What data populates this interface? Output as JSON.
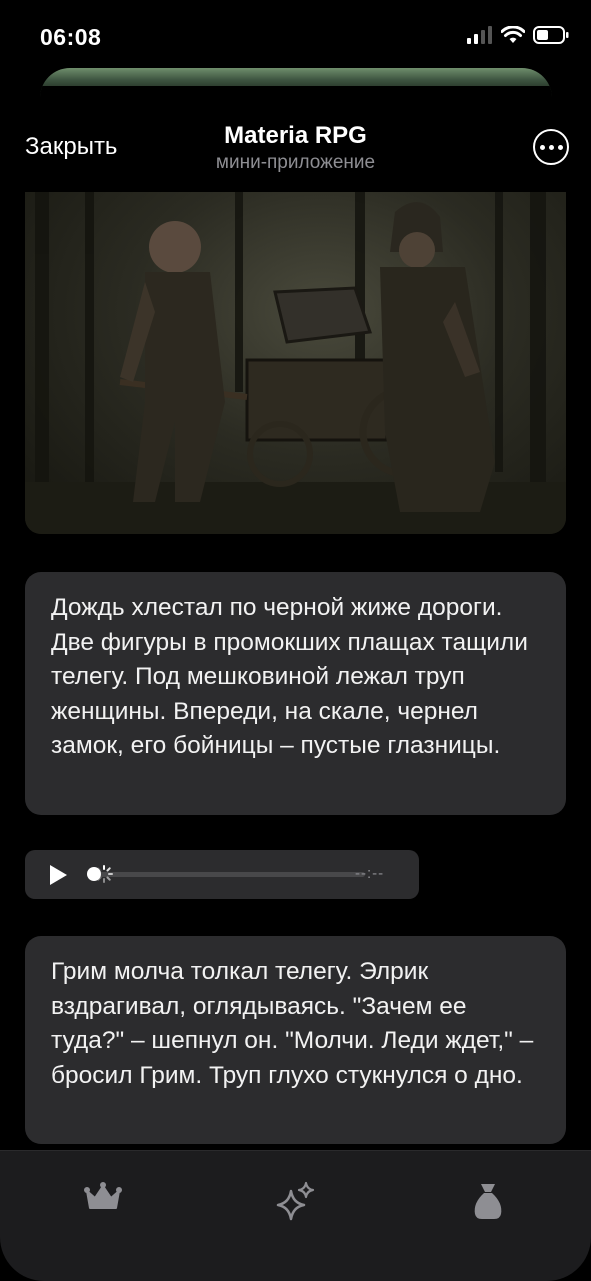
{
  "status_bar": {
    "time": "06:08",
    "icons": [
      "cellular-signal-icon",
      "wifi-icon",
      "battery-icon"
    ]
  },
  "header": {
    "close_label": "Закрыть",
    "title": "Materia RPG",
    "subtitle": "мини-приложение",
    "more_icon": "more-circle-icon"
  },
  "story": {
    "image_alt": "scene-illustration",
    "paragraph_1": "Дождь хлестал по черной жиже дороги. Две фигуры в промокших плащах тащили телегу. Под мешковиной лежал труп женщины. Впереди, на скале, чернел замок, его бойницы – пустые глазницы.",
    "audio": {
      "duration": "--:--",
      "progress": 0,
      "state": "loading"
    },
    "paragraph_2": "Грим молча толкал телегу. Элрик вздрагивал, оглядываясь. \"Зачем ее туда?\" – шепнул он. \"Молчи. Леди ждет,\" – бросил Грим. Труп глухо стукнулся о дно."
  },
  "tabs": [
    {
      "icon": "crown-icon"
    },
    {
      "icon": "sparkles-icon"
    },
    {
      "icon": "money-bag-icon"
    }
  ],
  "colors": {
    "background": "#000000",
    "bubble": "#2c2c2e",
    "tab_bar": "#1c1c1e",
    "secondary_text": "#8e8e93",
    "icon_gray": "#8e8e93"
  }
}
